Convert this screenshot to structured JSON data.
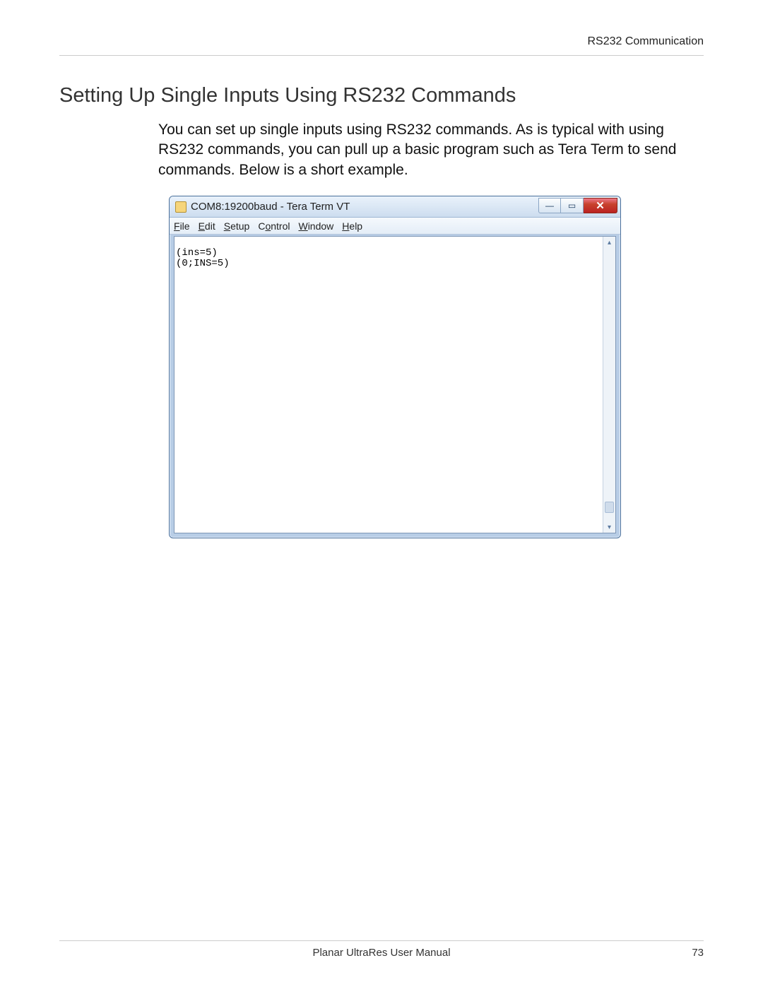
{
  "header": {
    "section": "RS232 Communication"
  },
  "section": {
    "title": "Setting Up Single Inputs Using RS232 Commands",
    "body": "You can set up single inputs using RS232 commands. As is typical with using RS232 commands, you can pull up a basic program such as Tera Term to send commands. Below is a short example."
  },
  "teraterm": {
    "title": "COM8:19200baud - Tera Term VT",
    "menus": {
      "file": "File",
      "edit": "Edit",
      "setup": "Setup",
      "control": "Control",
      "window": "Window",
      "help": "Help"
    },
    "console_lines": [
      "(ins=5)",
      "(0;INS=5)"
    ],
    "buttons": {
      "minimize_glyph": "—",
      "maximize_glyph": "▭",
      "close_glyph": "✕"
    },
    "scroll": {
      "up_glyph": "▴",
      "down_glyph": "▾"
    }
  },
  "footer": {
    "manual": "Planar UltraRes User Manual",
    "page": "73"
  }
}
